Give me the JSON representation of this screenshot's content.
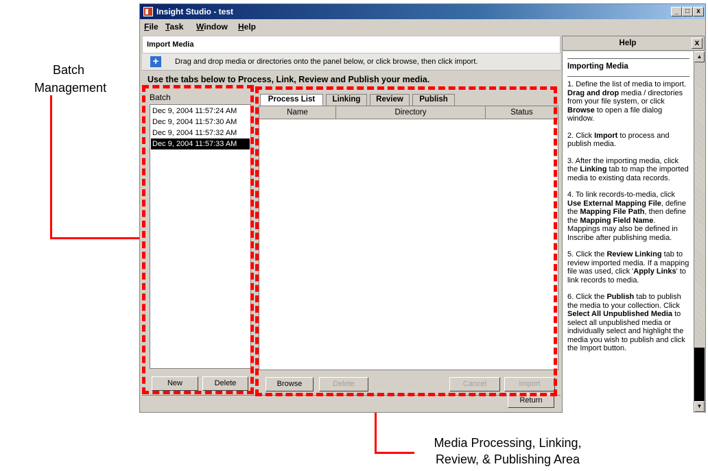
{
  "annotations": {
    "batch_management": [
      "Batch",
      "Management"
    ],
    "media_area": [
      "Media Processing, Linking,",
      "Review, & Publishing Area"
    ]
  },
  "window": {
    "title": "Insight Studio - test",
    "controls": [
      "_",
      "□",
      "x"
    ]
  },
  "menubar": {
    "items": [
      {
        "hotkey": "F",
        "rest": "ile"
      },
      {
        "hotkey": "T",
        "rest": "ask"
      },
      {
        "hotkey": "W",
        "rest": "indow"
      },
      {
        "hotkey": "H",
        "rest": "elp"
      }
    ]
  },
  "import": {
    "header": "Import Media",
    "drop_hint": "Drag and drop media or directories onto the panel below, or click browse, then click import.",
    "instructions": "Use the tabs below to Process, Link, Review and Publish your media."
  },
  "batch": {
    "label": "Batch",
    "items": [
      "Dec 9, 2004 11:57:24 AM",
      "Dec 9, 2004 11:57:30 AM",
      "Dec 9, 2004 11:57:32 AM",
      "Dec 9, 2004 11:57:33 AM"
    ],
    "selected_index": 3,
    "new_button": "New",
    "delete_button": "Delete"
  },
  "tabs": {
    "items": [
      "Process List",
      "Linking",
      "Review",
      "Publish"
    ],
    "active": "Process List"
  },
  "table": {
    "columns": [
      "Name",
      "Directory",
      "Status"
    ]
  },
  "buttons": {
    "browse": "Browse",
    "delete": "Delete",
    "cancel": "Cancel",
    "import": "Import",
    "return": "Return"
  },
  "help": {
    "header": "Help",
    "close": "x",
    "title": "Importing Media"
  },
  "colors": {
    "annotation_red": "#ff0000",
    "title_bar": "#0a246a",
    "selection": "#000000"
  }
}
